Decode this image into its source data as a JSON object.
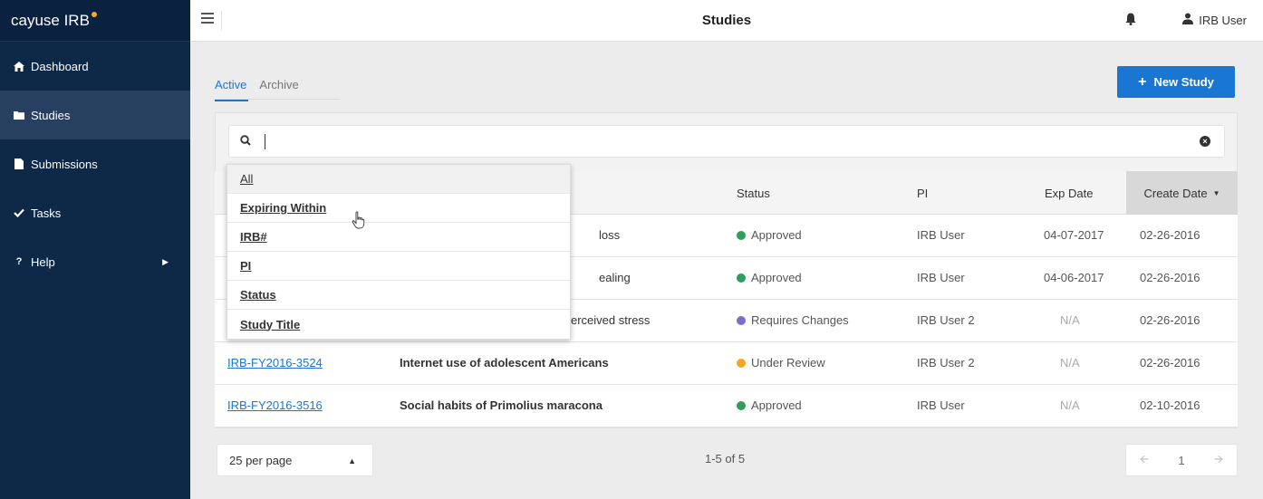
{
  "app": {
    "brand": "cayuse IRB",
    "brand_accent": "#f5a623"
  },
  "sidebar": {
    "items": [
      {
        "label": "Dashboard",
        "icon": "home-icon"
      },
      {
        "label": "Studies",
        "icon": "folder-icon",
        "active": true
      },
      {
        "label": "Submissions",
        "icon": "document-icon"
      },
      {
        "label": "Tasks",
        "icon": "check-icon"
      },
      {
        "label": "Help",
        "icon": "question-icon",
        "submenu": true
      }
    ]
  },
  "header": {
    "title": "Studies",
    "user_name": "IRB User"
  },
  "tabs": [
    {
      "label": "Active",
      "active": true
    },
    {
      "label": "Archive"
    }
  ],
  "new_study_label": "New Study",
  "search": {
    "value": "",
    "placeholder": ""
  },
  "filter_menu": {
    "options": [
      "All",
      "Expiring Within",
      "IRB#",
      "PI",
      "Status",
      "Study Title"
    ],
    "hovered": "Expiring Within"
  },
  "table": {
    "columns": {
      "status": "Status",
      "pi": "PI",
      "exp": "Exp Date",
      "create": "Create Date"
    },
    "rows": [
      {
        "irb": "",
        "title": "loss",
        "status": "Approved",
        "status_color": "#2e9e5b",
        "pi": "IRB User",
        "exp": "04-07-2017",
        "create": "02-26-2016"
      },
      {
        "irb": "",
        "title": "ealing",
        "status": "Approved",
        "status_color": "#2e9e5b",
        "pi": "IRB User",
        "exp": "04-06-2017",
        "create": "02-26-2016"
      },
      {
        "irb": "",
        "title": "erceived stress",
        "status": "Requires Changes",
        "status_color": "#7a6fd0",
        "pi": "IRB User 2",
        "exp": "N/A",
        "create": "02-26-2016"
      },
      {
        "irb": "IRB-FY2016-3524",
        "title": "Internet use of adolescent Americans",
        "status": "Under Review",
        "status_color": "#f5a623",
        "pi": "IRB User 2",
        "exp": "N/A",
        "create": "02-26-2016"
      },
      {
        "irb": "IRB-FY2016-3516",
        "title": "Social habits of Primolius maracona",
        "status": "Approved",
        "status_color": "#2e9e5b",
        "pi": "IRB User",
        "exp": "N/A",
        "create": "02-10-2016"
      }
    ]
  },
  "footer": {
    "per_page": "25 per page",
    "count": "1-5 of 5",
    "page": "1"
  },
  "colors": {
    "primary": "#1976d2",
    "sidebar_bg": "#0e2847",
    "sidebar_active": "#28405f"
  }
}
